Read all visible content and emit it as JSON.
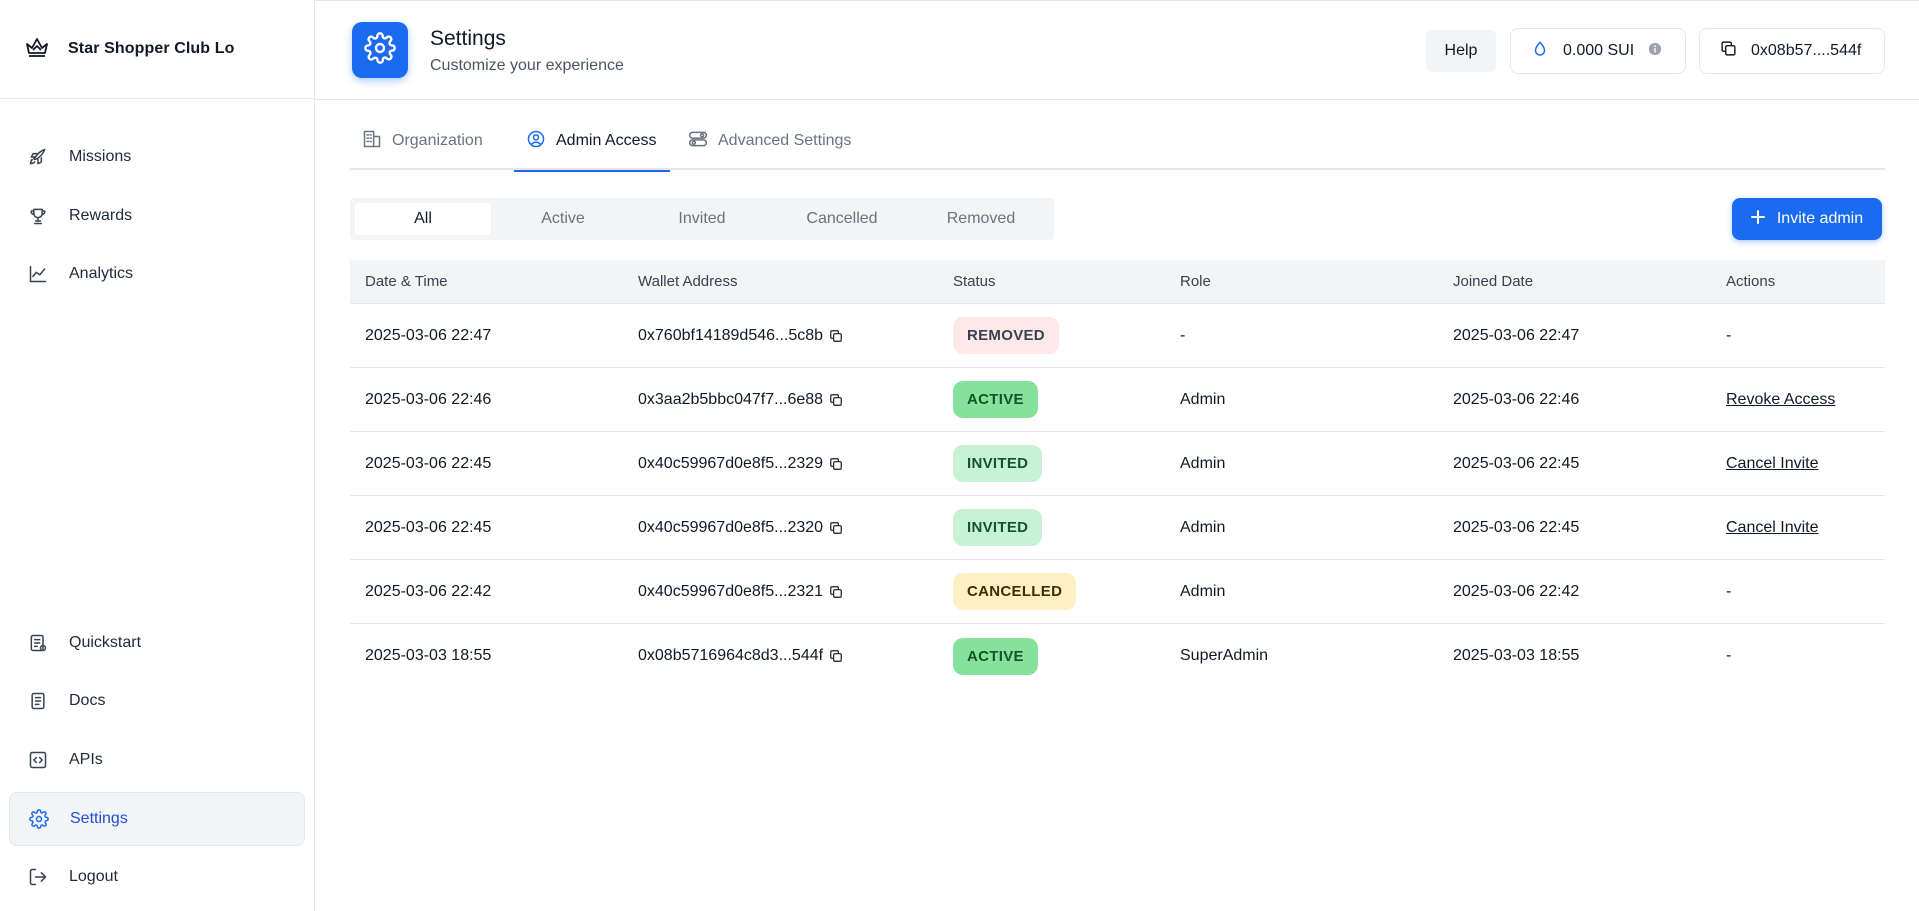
{
  "brand": {
    "name": "Star Shopper Club Lo"
  },
  "sidebar": {
    "top_items": [
      {
        "label": "Missions",
        "icon": "rocket-icon"
      },
      {
        "label": "Rewards",
        "icon": "trophy-icon"
      },
      {
        "label": "Analytics",
        "icon": "chart-line-icon"
      }
    ],
    "bottom_items": [
      {
        "label": "Quickstart",
        "icon": "clipboard-icon"
      },
      {
        "label": "Docs",
        "icon": "document-icon"
      },
      {
        "label": "APIs",
        "icon": "code-icon"
      },
      {
        "label": "Settings",
        "icon": "gear-icon",
        "active": true
      },
      {
        "label": "Logout",
        "icon": "logout-icon"
      }
    ]
  },
  "header": {
    "title": "Settings",
    "subtitle": "Customize your experience",
    "help_label": "Help",
    "balance": "0.000 SUI",
    "wallet": "0x08b57....544f"
  },
  "tabs": [
    {
      "label": "Organization",
      "icon": "building-icon"
    },
    {
      "label": "Admin Access",
      "icon": "user-circle-icon",
      "active": true
    },
    {
      "label": "Advanced Settings",
      "icon": "toggles-icon"
    }
  ],
  "filters": {
    "items": [
      "All",
      "Active",
      "Invited",
      "Cancelled",
      "Removed"
    ],
    "selected": "All"
  },
  "invite_button": {
    "label": "Invite admin"
  },
  "table": {
    "columns": [
      "Date & Time",
      "Wallet Address",
      "Status",
      "Role",
      "Joined Date",
      "Actions"
    ],
    "rows": [
      {
        "datetime": "2025-03-06 22:47",
        "wallet": "0x760bf14189d546...5c8b",
        "status": "REMOVED",
        "role": "-",
        "joined": "2025-03-06 22:47",
        "action": "-"
      },
      {
        "datetime": "2025-03-06 22:46",
        "wallet": "0x3aa2b5bbc047f7...6e88",
        "status": "ACTIVE",
        "role": "Admin",
        "joined": "2025-03-06 22:46",
        "action": "Revoke Access"
      },
      {
        "datetime": "2025-03-06 22:45",
        "wallet": "0x40c59967d0e8f5...2329",
        "status": "INVITED",
        "role": "Admin",
        "joined": "2025-03-06 22:45",
        "action": "Cancel Invite"
      },
      {
        "datetime": "2025-03-06 22:45",
        "wallet": "0x40c59967d0e8f5...2320",
        "status": "INVITED",
        "role": "Admin",
        "joined": "2025-03-06 22:45",
        "action": "Cancel Invite"
      },
      {
        "datetime": "2025-03-06 22:42",
        "wallet": "0x40c59967d0e8f5...2321",
        "status": "CANCELLED",
        "role": "Admin",
        "joined": "2025-03-06 22:42",
        "action": "-"
      },
      {
        "datetime": "2025-03-03 18:55",
        "wallet": "0x08b5716964c8d3...544f",
        "status": "ACTIVE",
        "role": "SuperAdmin",
        "joined": "2025-03-03 18:55",
        "action": "-"
      }
    ]
  },
  "colors": {
    "accent": "#1a6bf0",
    "removed": "#fde8e8",
    "active": "#86e29b",
    "invited": "#c8f2d6",
    "cancelled": "#fdf0c2"
  }
}
